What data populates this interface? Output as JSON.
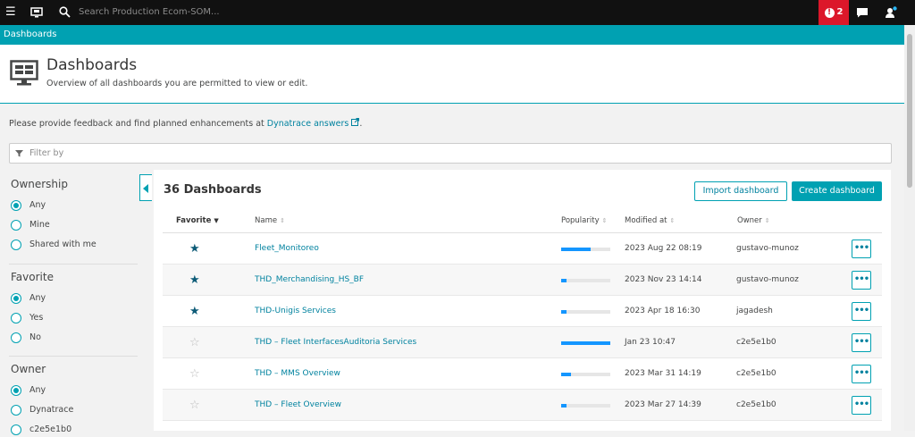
{
  "topbar": {
    "search_placeholder": "Search Production Ecom-SOM...",
    "alert_count": "2"
  },
  "breadcrumb": {
    "label": "Dashboards"
  },
  "header": {
    "title": "Dashboards",
    "subtitle": "Overview of all dashboards you are permitted to view or edit."
  },
  "feedback": {
    "text": "Please provide feedback and find planned enhancements at ",
    "link": "Dynatrace answers",
    "suffix": "."
  },
  "filter": {
    "placeholder": "Filter by"
  },
  "sidebar": {
    "ownership": {
      "title": "Ownership",
      "options": [
        "Any",
        "Mine",
        "Shared with me"
      ],
      "selected": "Any"
    },
    "favorite": {
      "title": "Favorite",
      "options": [
        "Any",
        "Yes",
        "No"
      ],
      "selected": "Any"
    },
    "owner": {
      "title": "Owner",
      "options": [
        "Any",
        "Dynatrace",
        "c2e5e1b0"
      ],
      "selected": "Any"
    }
  },
  "main": {
    "count_label": "36 Dashboards",
    "import_label": "Import dashboard",
    "create_label": "Create dashboard",
    "columns": [
      "Favorite",
      "Name",
      "Popularity",
      "Modified at",
      "Owner"
    ],
    "rows": [
      {
        "favorite": true,
        "name": "Fleet_Monitoreo",
        "popularity": 0.6,
        "modified": "2023 Aug 22 08:19",
        "owner": "gustavo-munoz"
      },
      {
        "favorite": true,
        "name": "THD_Merchandising_HS_BF",
        "popularity": 0.1,
        "modified": "2023 Nov 23 14:14",
        "owner": "gustavo-munoz"
      },
      {
        "favorite": true,
        "name": "THD-Unigis Services",
        "popularity": 0.1,
        "modified": "2023 Apr 18 16:30",
        "owner": "jagadesh"
      },
      {
        "favorite": false,
        "name": "THD – Fleet InterfacesAuditoria Services",
        "popularity": 1.0,
        "modified": "Jan 23 10:47",
        "owner": "c2e5e1b0"
      },
      {
        "favorite": false,
        "name": "THD – MMS Overview",
        "popularity": 0.2,
        "modified": "2023 Mar 31 14:19",
        "owner": "c2e5e1b0"
      },
      {
        "favorite": false,
        "name": "THD – Fleet Overview",
        "popularity": 0.1,
        "modified": "2023 Mar 27 14:39",
        "owner": "c2e5e1b0"
      }
    ]
  },
  "colors": {
    "accent": "#00a1b2",
    "link": "#00829f",
    "alert": "#dc172a",
    "popularity": "#1496ff",
    "star": "#0d5b77"
  }
}
